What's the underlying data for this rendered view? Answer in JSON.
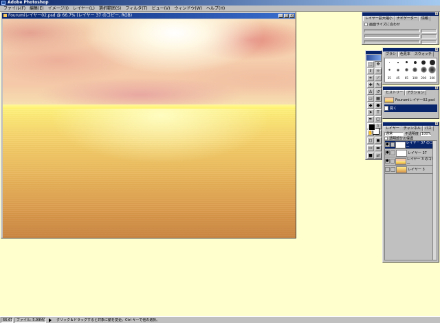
{
  "app": {
    "title": "Adobe Photoshop"
  },
  "menu": [
    "ファイル(F)",
    "編集(E)",
    "イメージ(I)",
    "レイヤー(L)",
    "選択範囲(S)",
    "フィルタ(T)",
    "ビュー(V)",
    "ウィンドウ(W)",
    "ヘルプ(H)"
  ],
  "document": {
    "title": "Fourumiレイヤー02.psd @ 66.7% (レイヤー 37 のコピー, RGB)"
  },
  "status": {
    "zoom": "66.67%",
    "file_size": "ファイル: 5.99M/34M",
    "hint": "クリック＆ドラッグすると対象に動を変更。Ctrl キーで他の選択。"
  },
  "options": {
    "tabs": [
      "レイヤー拡大縮小",
      "ナビゲーター",
      "情報"
    ],
    "checkbox_label": "画面サイズに合わせ",
    "rows": [
      "",
      "",
      ""
    ]
  },
  "brushes": {
    "tabs": [
      "ブラシ",
      "色見本",
      "スウォッチ"
    ],
    "labels": [
      "35",
      "45",
      "65",
      "100",
      "200",
      "300"
    ]
  },
  "history": {
    "tabs": [
      "ヒストリー",
      "アクション"
    ],
    "items": [
      "Fourumiレイヤー02.psd",
      "開く"
    ]
  },
  "layers": {
    "tabs": [
      "レイヤー",
      "チャンネル",
      "パス"
    ],
    "blend_mode": "通常",
    "opacity_label": "不透明度",
    "opacity_value": "100%",
    "lock_label": "透明部分の保護",
    "items": [
      {
        "name": "レイヤー 37 のコピー",
        "active": true,
        "thumb": "white"
      },
      {
        "name": "レイヤー 37",
        "active": false,
        "thumb": "white"
      },
      {
        "name": "レイヤー 3 のコピー",
        "active": false,
        "thumb": "sky"
      },
      {
        "name": "レイヤー 3",
        "active": false,
        "thumb": "gold"
      }
    ]
  },
  "icons": {
    "app": "photoshop-icon",
    "status": "play-arrow-icon"
  }
}
